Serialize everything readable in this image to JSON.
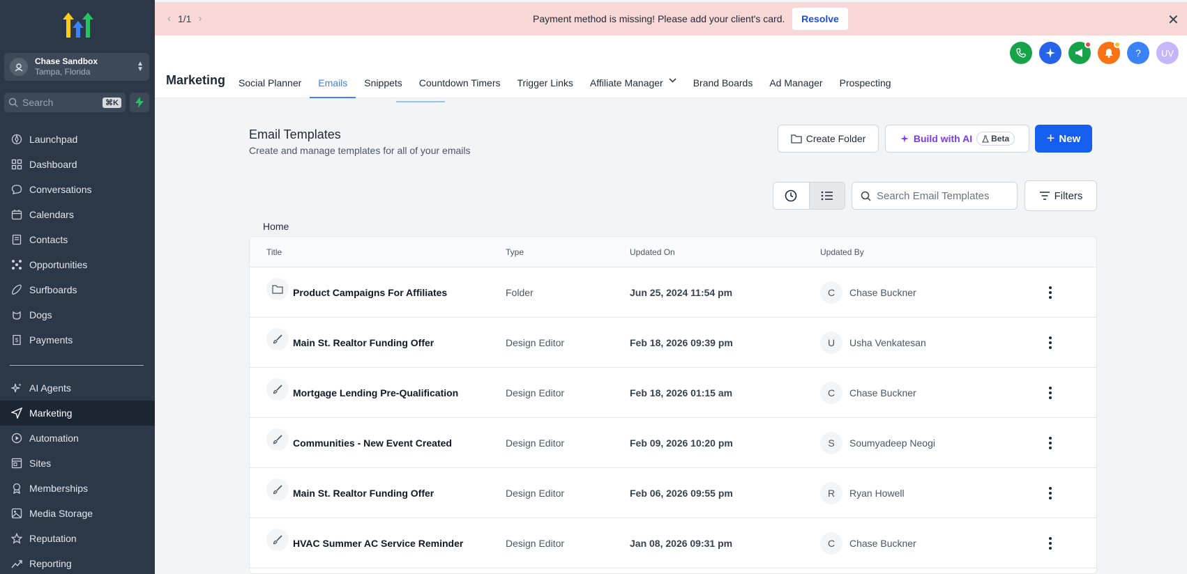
{
  "account": {
    "name": "Chase Sandbox",
    "location": "Tampa, Florida"
  },
  "sidebar": {
    "search_placeholder": "Search",
    "search_shortcut": "⌘K",
    "items": [
      {
        "label": "Launchpad",
        "icon": "rocket-icon"
      },
      {
        "label": "Dashboard",
        "icon": "grid-icon"
      },
      {
        "label": "Conversations",
        "icon": "chat-icon"
      },
      {
        "label": "Calendars",
        "icon": "calendar-icon"
      },
      {
        "label": "Contacts",
        "icon": "contacts-icon"
      },
      {
        "label": "Opportunities",
        "icon": "network-icon"
      },
      {
        "label": "Surfboards",
        "icon": "surfboard-icon"
      },
      {
        "label": "Dogs",
        "icon": "dog-icon"
      },
      {
        "label": "Payments",
        "icon": "receipt-icon"
      },
      {
        "label": "AI Agents",
        "icon": "sparkle-icon"
      },
      {
        "label": "Marketing",
        "icon": "send-icon"
      },
      {
        "label": "Automation",
        "icon": "automation-icon"
      },
      {
        "label": "Sites",
        "icon": "sites-icon"
      },
      {
        "label": "Memberships",
        "icon": "badge-icon"
      },
      {
        "label": "Media Storage",
        "icon": "image-icon"
      },
      {
        "label": "Reputation",
        "icon": "star-icon"
      },
      {
        "label": "Reporting",
        "icon": "chart-icon"
      }
    ],
    "active": "Marketing"
  },
  "banner": {
    "pager": "1/1",
    "message": "Payment method is missing! Please add your client's card.",
    "resolve_label": "Resolve"
  },
  "header": {
    "title": "Marketing",
    "tabs": [
      "Social Planner",
      "Emails",
      "Snippets",
      "Countdown Timers",
      "Trigger Links",
      "Affiliate Manager",
      "Brand Boards",
      "Ad Manager",
      "Prospecting"
    ],
    "active_tab": "Emails",
    "avatar_initials": "UV",
    "help_label": "?",
    "colors": {
      "phone": "#16a34a",
      "ai": "#2563eb",
      "announce": "#16a34a",
      "bell": "#f97316",
      "help": "#3b82f6",
      "avatar": "#c4b5fd"
    }
  },
  "templates": {
    "title": "Email Templates",
    "subtitle": "Create and manage templates for all of your emails",
    "create_folder_label": "Create Folder",
    "build_ai_label": "Build with AI",
    "beta_label": "Beta",
    "new_label": "New",
    "search_placeholder": "Search Email Templates",
    "filters_label": "Filters",
    "breadcrumb": "Home",
    "columns": [
      "Title",
      "Type",
      "Updated On",
      "Updated By"
    ],
    "rows": [
      {
        "icon": "folder-icon",
        "title": "Product Campaigns For Affiliates",
        "type": "Folder",
        "updated_on": "Jun 25, 2024 11:54 pm",
        "initial": "C",
        "updated_by": "Chase Buckner"
      },
      {
        "icon": "brush-icon",
        "title": "Main St. Realtor Funding Offer",
        "type": "Design Editor",
        "updated_on": "Feb 18, 2026 09:39 pm",
        "initial": "U",
        "updated_by": "Usha Venkatesan"
      },
      {
        "icon": "brush-icon",
        "title": "Mortgage Lending Pre-Qualification",
        "type": "Design Editor",
        "updated_on": "Feb 18, 2026 01:15 am",
        "initial": "C",
        "updated_by": "Chase Buckner"
      },
      {
        "icon": "brush-icon",
        "title": "Communities - New Event Created",
        "type": "Design Editor",
        "updated_on": "Feb 09, 2026 10:20 pm",
        "initial": "S",
        "updated_by": "Soumyadeep Neogi"
      },
      {
        "icon": "brush-icon",
        "title": "Main St. Realtor Funding Offer",
        "type": "Design Editor",
        "updated_on": "Feb 06, 2026 09:55 pm",
        "initial": "R",
        "updated_by": "Ryan Howell"
      },
      {
        "icon": "brush-icon",
        "title": "HVAC Summer AC Service Reminder",
        "type": "Design Editor",
        "updated_on": "Jan 08, 2026 09:31 pm",
        "initial": "C",
        "updated_by": "Chase Buckner"
      }
    ]
  }
}
